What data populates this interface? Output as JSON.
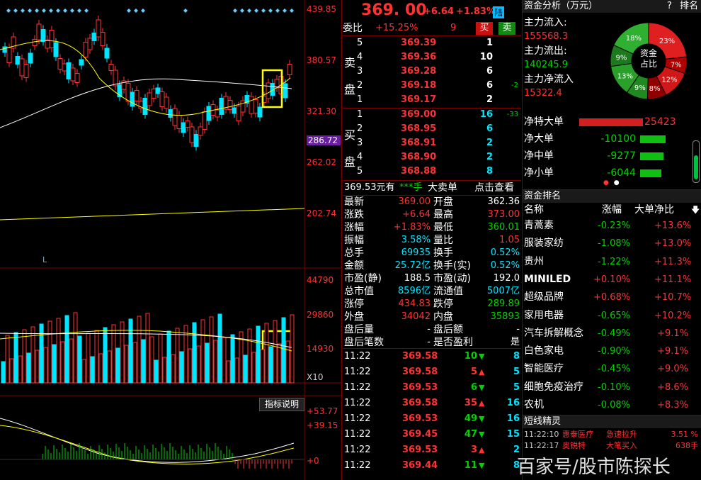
{
  "colors": {
    "up": "#ff3232",
    "down": "#00d200",
    "cyan": "#00e5ff",
    "yellow": "#ffff00",
    "grid": "#7a0000",
    "bg": "#000000"
  },
  "chart": {
    "price_labels": [
      "439.85",
      "380.57",
      "321.30",
      "286.72",
      "262.02",
      "202.74"
    ],
    "current_price_tag": "286.72",
    "l_marker": "L",
    "vol_labels": [
      "44790",
      "29860",
      "14930"
    ],
    "vol_unit": "X10",
    "indicator_button": "指标说明",
    "macd_labels": [
      "+53.77",
      "+39.15",
      "+0"
    ]
  },
  "quote": {
    "price": "369. 00",
    "change": "+6.64",
    "change_pct": "+1.83%",
    "market_tag": "陆",
    "weibi_label": "委比",
    "weibi_value": "+15.25%",
    "weibi_diff": "9",
    "buy_btn": "买",
    "sell_btn": "卖"
  },
  "sell_side": {
    "label1": "卖",
    "label2": "盘",
    "rows": [
      {
        "lvl": "5",
        "price": "369.39",
        "vol": "1",
        "chg": ""
      },
      {
        "lvl": "4",
        "price": "369.36",
        "vol": "10",
        "chg": ""
      },
      {
        "lvl": "3",
        "price": "369.28",
        "vol": "6",
        "chg": ""
      },
      {
        "lvl": "2",
        "price": "369.18",
        "vol": "6",
        "chg": "-2"
      },
      {
        "lvl": "1",
        "price": "369.17",
        "vol": "2",
        "chg": ""
      }
    ]
  },
  "buy_side": {
    "label1": "买",
    "label2": "盘",
    "rows": [
      {
        "lvl": "1",
        "price": "369.00",
        "vol": "16",
        "chg": "-33"
      },
      {
        "lvl": "2",
        "price": "368.95",
        "vol": "6",
        "chg": ""
      },
      {
        "lvl": "3",
        "price": "368.91",
        "vol": "2",
        "chg": ""
      },
      {
        "lvl": "4",
        "price": "368.90",
        "vol": "2",
        "chg": ""
      },
      {
        "lvl": "5",
        "price": "368.88",
        "vol": "8",
        "chg": ""
      }
    ]
  },
  "bigorder": {
    "amount": "369.53元有",
    "hand": "***手",
    "type": "大卖单",
    "link": "点击查看"
  },
  "stats": [
    {
      "l1": "最新",
      "v1": "369.00",
      "c1": "red",
      "l2": "开盘",
      "v2": "362.36",
      "c2": "white"
    },
    {
      "l1": "涨跌",
      "v1": "+6.64",
      "c1": "red",
      "l2": "最高",
      "v2": "373.00",
      "c2": "red"
    },
    {
      "l1": "涨幅",
      "v1": "+1.83%",
      "c1": "red",
      "l2": "最低",
      "v2": "360.01",
      "c2": "green"
    },
    {
      "l1": "振幅",
      "v1": "3.58%",
      "c1": "cyan",
      "l2": "量比",
      "v2": "1.05",
      "c2": "red"
    },
    {
      "l1": "总手",
      "v1": "69935",
      "c1": "cyan",
      "l2": "换手",
      "v2": "0.52%",
      "c2": "cyan"
    },
    {
      "l1": "金额",
      "v1": "25.72亿",
      "c1": "cyan",
      "l2": "换手(实)",
      "v2": "0.52%",
      "c2": "cyan"
    },
    {
      "l1": "市盈(静)",
      "v1": "188.5",
      "c1": "white",
      "l2": "市盈(动)",
      "v2": "192.0",
      "c2": "white"
    },
    {
      "l1": "总市值",
      "v1": "8596亿",
      "c1": "cyan",
      "l2": "流通值",
      "v2": "5007亿",
      "c2": "cyan"
    },
    {
      "l1": "涨停",
      "v1": "434.83",
      "c1": "red",
      "l2": "跌停",
      "v2": "289.89",
      "c2": "green"
    },
    {
      "l1": "外盘",
      "v1": "34042",
      "c1": "red",
      "l2": "内盘",
      "v2": "35893",
      "c2": "green"
    },
    {
      "l1": "盘后量",
      "v1": "-",
      "c1": "white",
      "l2": "盘后额",
      "v2": "-",
      "c2": "white"
    },
    {
      "l1": "盘后笔数",
      "v1": "-",
      "c1": "white",
      "l2": "是否盈利",
      "v2": "是",
      "c2": "white"
    }
  ],
  "ticks": [
    {
      "time": "11:22",
      "price": "369.58",
      "vol": "10",
      "dir": "down",
      "n": "8"
    },
    {
      "time": "11:22",
      "price": "369.58",
      "vol": "5",
      "dir": "up",
      "n": "5"
    },
    {
      "time": "11:22",
      "price": "369.53",
      "vol": "6",
      "dir": "down",
      "n": "5"
    },
    {
      "time": "11:22",
      "price": "369.58",
      "vol": "35",
      "dir": "up",
      "n": "16"
    },
    {
      "time": "11:22",
      "price": "369.53",
      "vol": "49",
      "dir": "down",
      "n": "16"
    },
    {
      "time": "11:22",
      "price": "369.45",
      "vol": "47",
      "dir": "down",
      "n": "15"
    },
    {
      "time": "11:22",
      "price": "369.53",
      "vol": "3",
      "dir": "up",
      "n": "2"
    },
    {
      "time": "11:22",
      "price": "369.44",
      "vol": "11",
      "dir": "down",
      "n": "8"
    }
  ],
  "fund": {
    "title": "资金分析（万元）",
    "help": "?",
    "rank_link": "排名",
    "main_in_label": "主力流入:",
    "main_in": "155568.3",
    "main_out_label": "主力流出:",
    "main_out": "140245.9",
    "main_net_label": "主力净流入",
    "main_net": "15322.4",
    "donut_center1": "资金",
    "donut_center2": "占比",
    "donut": [
      {
        "pct": "23%",
        "value": 23,
        "color": "#e02020"
      },
      {
        "pct": "7%",
        "value": 7,
        "color": "#b00000"
      },
      {
        "pct": "12%",
        "value": 12,
        "color": "#d01818"
      },
      {
        "pct": "8%",
        "value": 8,
        "color": "#900000"
      },
      {
        "pct": "9%",
        "value": 9,
        "color": "#208a20"
      },
      {
        "pct": "13%",
        "value": 13,
        "color": "#2aa02a"
      },
      {
        "pct": "9%",
        "value": 9,
        "color": "#1c7a1c"
      },
      {
        "pct": "18%",
        "value": 18,
        "color": "#30b030"
      }
    ],
    "flows": [
      {
        "label": "净特大单",
        "value": "25423",
        "dir": "up",
        "amount": 25423
      },
      {
        "label": "净大单",
        "value": "-10100",
        "dir": "down",
        "amount": 10100
      },
      {
        "label": "净中单",
        "value": "-9277",
        "dir": "down",
        "amount": 9277
      },
      {
        "label": "净小单",
        "value": "-6044",
        "dir": "down",
        "amount": 6044
      }
    ]
  },
  "ranking": {
    "title": "资金排名",
    "col_name": "名称",
    "col_change": "涨幅",
    "col_net": "大单净比",
    "rows": [
      {
        "name": "青蒿素",
        "chg": "-0.23%",
        "net": "+13.6%"
      },
      {
        "name": "服装家纺",
        "chg": "-1.08%",
        "net": "+13.0%"
      },
      {
        "name": "贵州",
        "chg": "-1.22%",
        "net": "+11.3%"
      },
      {
        "name": "MINILED",
        "chg": "+0.10%",
        "net": "+11.1%"
      },
      {
        "name": "超级品牌",
        "chg": "+0.68%",
        "net": "+10.7%"
      },
      {
        "name": "家用电器",
        "chg": "-0.65%",
        "net": "+10.2%"
      },
      {
        "name": "汽车拆解概念",
        "chg": "-0.49%",
        "net": "+9.1%"
      },
      {
        "name": "白色家电",
        "chg": "-0.90%",
        "net": "+9.1%"
      },
      {
        "name": "智能医疗",
        "chg": "-0.45%",
        "net": "+9.0%"
      },
      {
        "name": "细胞免疫治疗",
        "chg": "-0.10%",
        "net": "+8.6%"
      },
      {
        "name": "农机",
        "chg": "-0.08%",
        "net": "+8.3%"
      }
    ]
  },
  "shortline": {
    "title": "短线精灵",
    "rows": [
      {
        "time": "11:22:10",
        "name": "惠泰医疗",
        "event": "急速拉升",
        "value": "3.51 %"
      },
      {
        "time": "11:22:17",
        "name": "奥锐特",
        "event": "大笔买入",
        "value": "638手"
      }
    ]
  },
  "watermark": "百家号/股市陈探长"
}
